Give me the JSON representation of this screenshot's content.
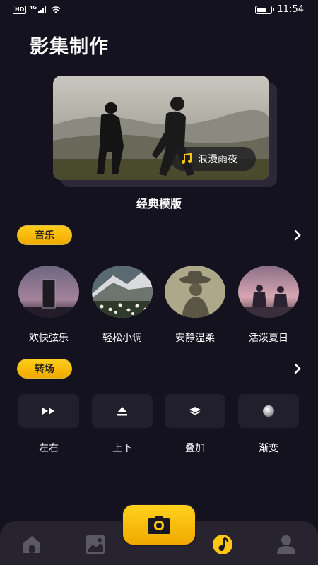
{
  "status_bar": {
    "hd": "HD",
    "network": "4G",
    "time": "11:54",
    "battery_level": 0.85
  },
  "header": {
    "title": "影集制作"
  },
  "template": {
    "label": "经典模版",
    "music_name": "浪漫雨夜",
    "music_icon": "music-note-icon"
  },
  "music_section": {
    "title": "音乐",
    "more_icon": "chevron-right-icon",
    "items": [
      {
        "label": "欢快弦乐"
      },
      {
        "label": "轻松小调"
      },
      {
        "label": "安静温柔"
      },
      {
        "label": "活泼夏日"
      }
    ]
  },
  "transition_section": {
    "title": "转场",
    "more_icon": "chevron-right-icon",
    "items": [
      {
        "label": "左右",
        "icon": "fast-forward-icon"
      },
      {
        "label": "上下",
        "icon": "eject-icon"
      },
      {
        "label": "叠加",
        "icon": "layers-icon"
      },
      {
        "label": "渐变",
        "icon": "gradient-sphere-icon"
      }
    ]
  },
  "bottom_nav": {
    "items": [
      {
        "icon": "home-icon"
      },
      {
        "icon": "gallery-icon"
      },
      {
        "icon": "camera-icon"
      },
      {
        "icon": "music-icon",
        "active": true
      },
      {
        "icon": "profile-icon"
      }
    ]
  },
  "colors": {
    "background": "#15121f",
    "accent": "#ffc70f",
    "card": "#221f2c",
    "nav": "#27232f"
  }
}
